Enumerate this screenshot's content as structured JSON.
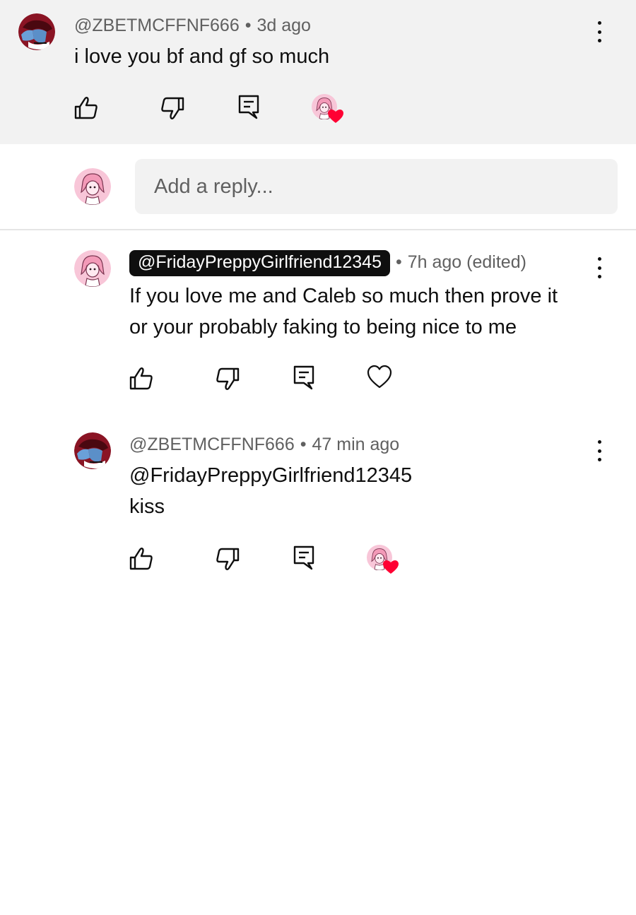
{
  "top_comment": {
    "author": "@ZBETMCFFNF666",
    "separator": "•",
    "time": "3d ago",
    "text": "i love you bf and gf so much"
  },
  "reply_box": {
    "placeholder": "Add a reply..."
  },
  "replies": [
    {
      "author": "@FridayPreppyGirlfriend12345",
      "separator": "•",
      "time": "7h ago (edited)",
      "text_line1": "If you love me and Caleb so much then prove it",
      "text_line2": "or your probably faking to being nice to me"
    },
    {
      "author": "@ZBETMCFFNF666",
      "separator": "•",
      "time": "47 min ago",
      "text_line1": "@FridayPreppyGirlfriend12345",
      "text_line2": "kiss"
    }
  ],
  "icons": {
    "like": "thumbs-up-icon",
    "dislike": "thumbs-down-icon",
    "reply": "reply-icon",
    "heart": "heart-icon",
    "more": "more-vertical-icon"
  },
  "colors": {
    "heart_red": "#ff0033",
    "creator_pink": "#f8c6d8",
    "avatar_maroon": "#7a1020",
    "avatar_blue": "#6aa0d8"
  }
}
